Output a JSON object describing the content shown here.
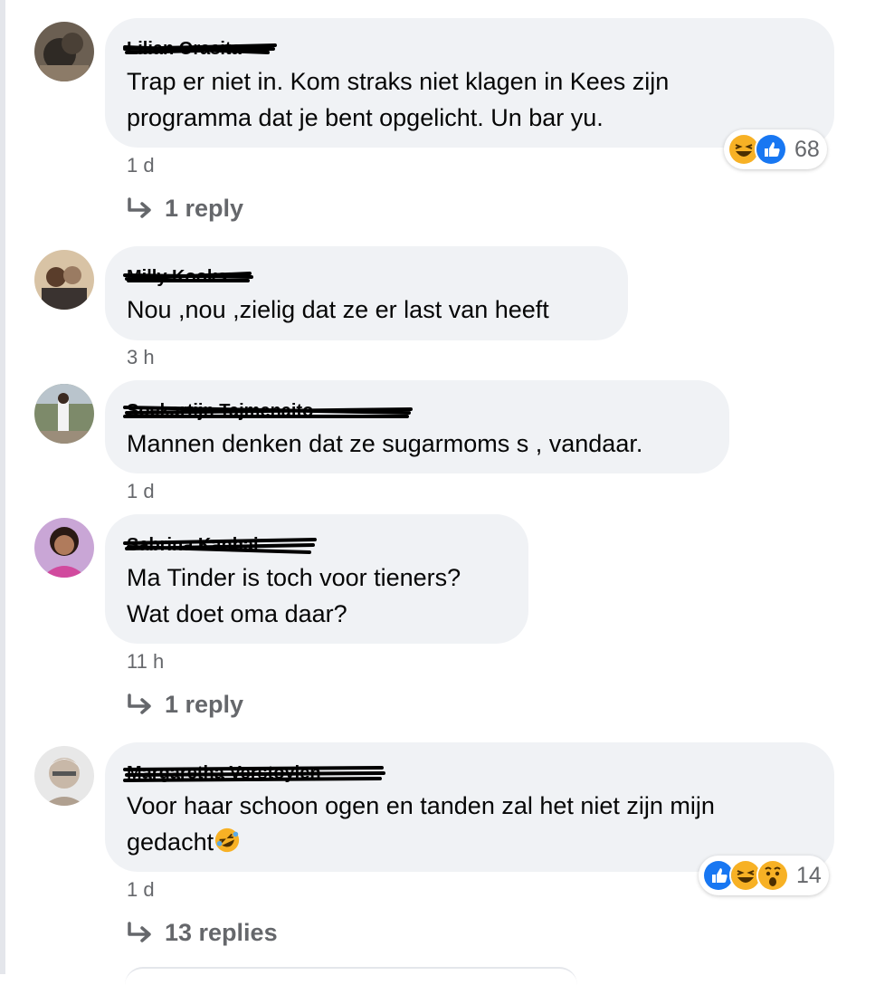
{
  "comments": [
    {
      "author": "Lilian Orasita",
      "text": "Trap er niet in. Kom straks niet klagen in Kees zijn\nprogramma dat je bent opgelicht. Un bar yu.",
      "time": "1 d",
      "reactions": {
        "icons": [
          "laugh-icon",
          "like-icon"
        ],
        "count": "68"
      },
      "reply_label": "1 reply"
    },
    {
      "author": "Milly Kooks",
      "text": "Nou ,nou ,zielig dat ze er last van heeft",
      "time": "3 h"
    },
    {
      "author": "Soekartijn Tajmenaito",
      "text": "Mannen denken dat ze sugarmoms s , vandaar.",
      "time": "1 d"
    },
    {
      "author": "Sabrina Kanhai",
      "text": "Ma Tinder is toch voor tieners?\nWat doet oma daar?",
      "time": "11 h",
      "reply_label": "1 reply"
    },
    {
      "author": "Margaretha Verstoylen",
      "text": "Voor haar schoon ogen en tanden zal het niet zijn mijn\ngedacht",
      "time": "1 d",
      "reactions": {
        "icons": [
          "like-icon",
          "laugh-icon",
          "wow-icon"
        ],
        "count": "14"
      },
      "reply_label": "13 replies"
    }
  ],
  "colors": {
    "bubble": "#f0f2f5",
    "meta_text": "#65676b",
    "like_blue": "#1877f2",
    "emoji_yellow": "#f7b125"
  }
}
